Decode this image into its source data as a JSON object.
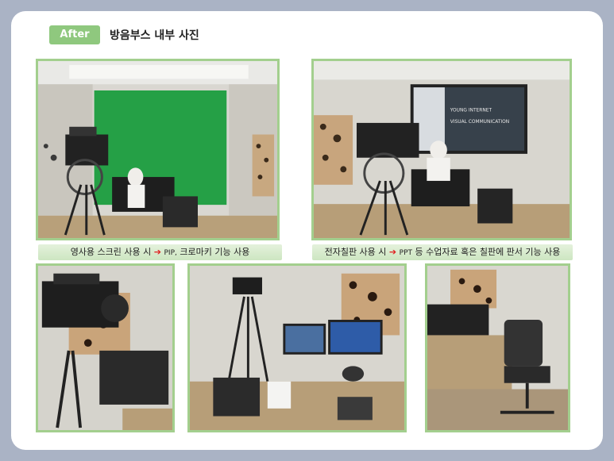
{
  "badge": "After",
  "title": "방음부스 내부 사진",
  "captions": {
    "left": {
      "pre": "영사용 스크린 사용 시",
      "arrow": "➔",
      "tag": "PIP,",
      "post": "크로마키 기능 사용"
    },
    "right": {
      "pre": "전자칠판 사용 시",
      "arrow": "➔",
      "tag": "PPT",
      "post": "등 수업자료 혹은 칠판에 판서 기능 사용"
    }
  },
  "colors": {
    "accent": "#8fc87e",
    "border": "#a3cf8e",
    "frame": "#aab3c5",
    "arrow": "#e02020"
  },
  "screen_text": {
    "line1": "YOUNG INTERNET",
    "line2": "VISUAL COMMUNICATION"
  },
  "photos": [
    {
      "name": "green-screen-photo"
    },
    {
      "name": "electronic-board-photo"
    },
    {
      "name": "camera-closeup-photo"
    },
    {
      "name": "control-desk-photo"
    },
    {
      "name": "chair-desk-photo"
    }
  ]
}
